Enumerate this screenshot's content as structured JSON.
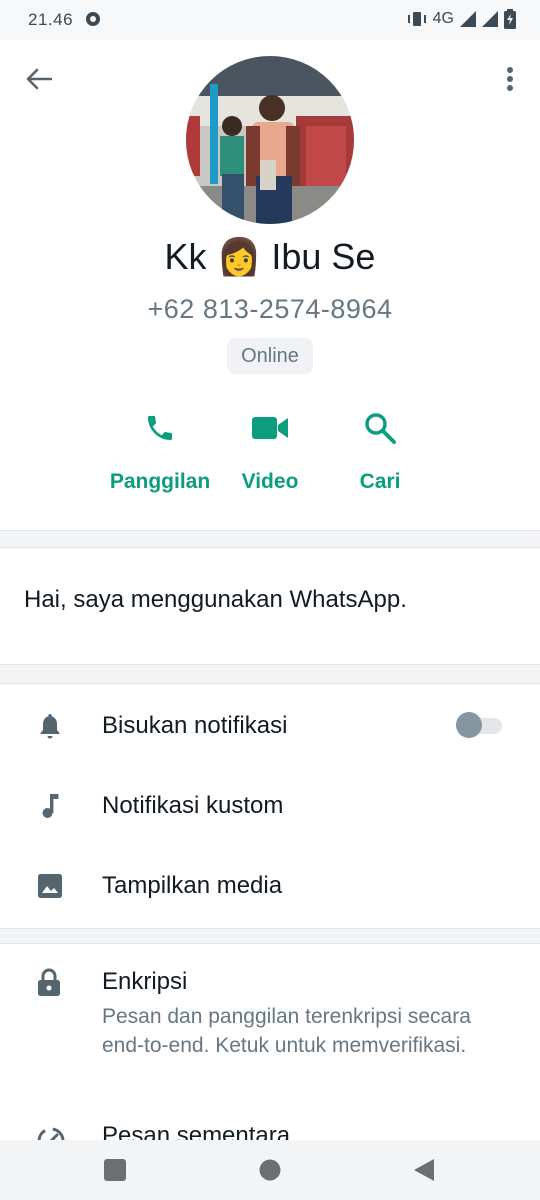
{
  "status_bar": {
    "time": "21.46",
    "network": "4G"
  },
  "header": {
    "contact_name": "Kk 👩 Ibu Se",
    "phone": "+62 813-2574-8964",
    "presence": "Online"
  },
  "actions": [
    {
      "label": "Panggilan",
      "icon": "phone-icon"
    },
    {
      "label": "Video",
      "icon": "video-icon"
    },
    {
      "label": "Cari",
      "icon": "search-icon"
    }
  ],
  "about": {
    "text": "Hai, saya menggunakan WhatsApp."
  },
  "settings": [
    {
      "label": "Bisukan notifikasi",
      "icon": "bell-icon",
      "toggle": false
    },
    {
      "label": "Notifikasi kustom",
      "icon": "music-note-icon"
    },
    {
      "label": "Tampilkan media",
      "icon": "image-icon"
    }
  ],
  "security": {
    "title": "Enkripsi",
    "description": "Pesan dan panggilan terenkripsi secara end-to-end. Ketuk untuk memverifikasi.",
    "next_item": "Pesan sementara"
  },
  "colors": {
    "accent": "#0a9e7e",
    "text_primary": "#111b21",
    "text_secondary": "#667781"
  }
}
